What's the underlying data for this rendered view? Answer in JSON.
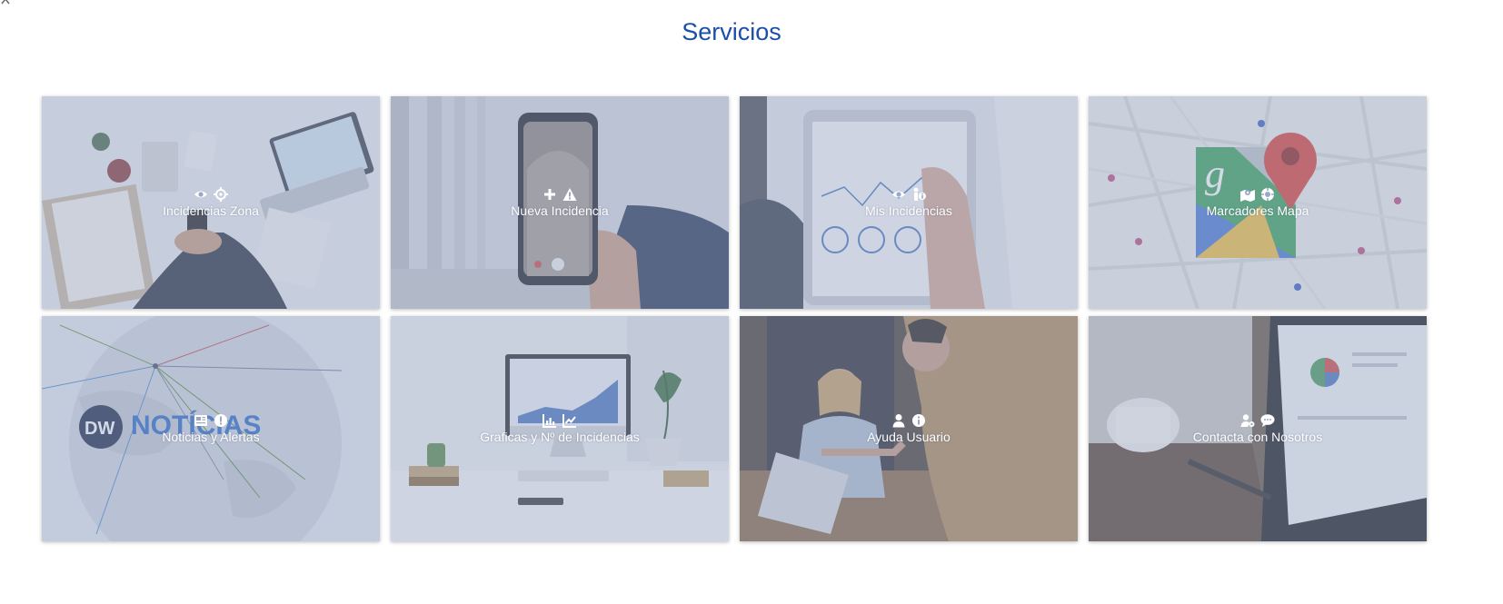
{
  "page": {
    "title": "Servicios"
  },
  "cards": [
    {
      "label": "Incidencias Zona",
      "icons": [
        "eye-icon",
        "crosshairs-icon"
      ]
    },
    {
      "label": "Nueva Incidencia",
      "icons": [
        "plus-icon",
        "warning-icon"
      ]
    },
    {
      "label": "Mis Incidencias",
      "icons": [
        "eye-icon",
        "person-info-icon"
      ]
    },
    {
      "label": "Marcadores Mapa",
      "icons": [
        "map-marked-icon",
        "location-crosshairs-icon"
      ]
    },
    {
      "label": "Noticias y Alertas",
      "icons": [
        "newspaper-icon",
        "exclamation-circle-icon"
      ]
    },
    {
      "label": "Graficas y Nº de Incidencias",
      "icons": [
        "bar-chart-icon",
        "line-chart-icon"
      ]
    },
    {
      "label": "Ayuda Usuario",
      "icons": [
        "user-icon",
        "info-circle-icon"
      ]
    },
    {
      "label": "Contacta con Nosotros",
      "icons": [
        "user-gear-icon",
        "comment-icon"
      ]
    }
  ],
  "logo_text": "NOTÍCIAS",
  "colors": {
    "title": "#1c4fa8",
    "overlay": "#96a4c4",
    "label": "#ffffff"
  }
}
